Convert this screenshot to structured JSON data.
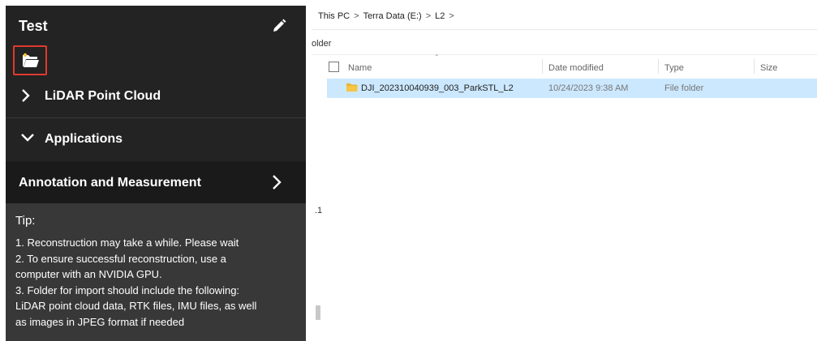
{
  "panel": {
    "title": "Test",
    "sections": {
      "lidar": "LiDAR Point Cloud",
      "applications": "Applications",
      "annotation": "Annotation and Measurement"
    },
    "tip": {
      "title": "Tip:",
      "lines": [
        "1. Reconstruction may take a while. Please wait",
        "2. To ensure successful reconstruction, use a",
        "computer with an NVIDIA GPU.",
        "3. Folder for import should include the following:",
        "LiDAR point cloud data, RTK files, IMU files, as well",
        "as images in JPEG format if needed"
      ]
    }
  },
  "explorer": {
    "breadcrumb": [
      "This PC",
      "Terra Data (E:)",
      "L2"
    ],
    "command_partial": "older",
    "stray_text": ".1",
    "columns": {
      "name": "Name",
      "date": "Date modified",
      "type": "Type",
      "size": "Size"
    },
    "rows": [
      {
        "name": "DJI_202310040939_003_ParkSTL_L2",
        "date": "10/24/2023 9:38 AM",
        "type": "File folder",
        "size": ""
      }
    ]
  },
  "colors": {
    "panel_bg": "#232323",
    "tip_bg": "#383838",
    "highlight_border": "#e03a2f",
    "selected_row": "#cce8ff",
    "folder_yellow": "#f5c543"
  },
  "icons": [
    "pencil-icon",
    "open-folder-icon",
    "chevron-right-icon",
    "chevron-down-icon",
    "folder-icon"
  ]
}
